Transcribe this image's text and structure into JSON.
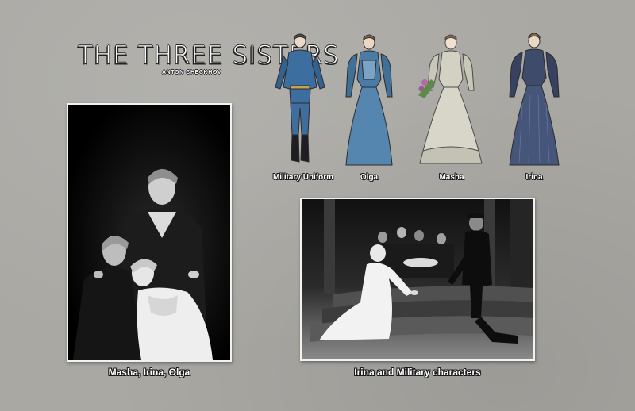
{
  "logo": {
    "title": "THE THREE SISTERS",
    "author": "ANTON CHECKHOV"
  },
  "costumes": [
    {
      "label": "Military Uniform",
      "color": "#3d6ea0"
    },
    {
      "label": "Olga",
      "color": "#4a7ca6"
    },
    {
      "label": "Masha",
      "color": "#c9c8b8"
    },
    {
      "label": "Irina",
      "color": "#3e4b6b"
    }
  ],
  "photos": {
    "sisters_caption": "Masha, Irina, Olga",
    "stage_caption": "Irina and Military characters"
  }
}
